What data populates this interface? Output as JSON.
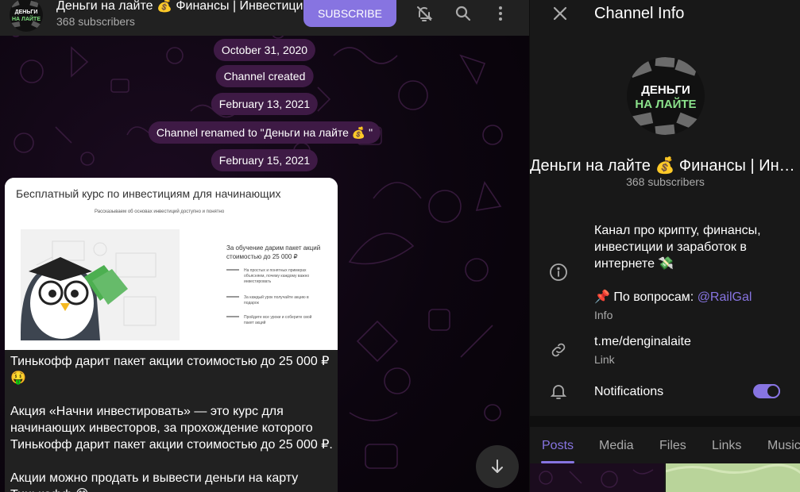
{
  "header": {
    "title": "Деньги на лайте 💰  Финансы | Инвестиции",
    "subscribers": "368 subscribers",
    "subscribe_label": "SUBSCRIBE"
  },
  "timeline": [
    {
      "kind": "date",
      "text": "October 31, 2020"
    },
    {
      "kind": "service",
      "text": "Channel created"
    },
    {
      "kind": "date",
      "text": "February 13, 2021"
    },
    {
      "kind": "service",
      "text": "Channel renamed to \"Деньги на лайте 💰 \""
    },
    {
      "kind": "date",
      "text": "February 15, 2021"
    }
  ],
  "post": {
    "image": {
      "heading": "Бесплатный курс по инвестициям для начинающих",
      "subheading": "Рассказываем об основах инвестиций доступно и понятно",
      "offer": "За обучение дарим пакет акций стоимостью до 25 000 ₽",
      "bullets": [
        "На простых и понятных примерах объясняем, почему каждому важно инвестировать",
        "За каждый урок получайте акцию в подарок",
        "Пройдите все уроки и соберите свой пакет акций"
      ]
    },
    "text": "Тинькофф дарит пакет акции стоимостью до 25 000 ₽ 🤑\n\nАкция «Начни инвестировать» — это курс для начинающих инвесторов, за прохождение которого Тинькофф дарит пакет акции стоимостью до 25 000 ₽.\n\nАкции можно продать и вывести деньги на карту Тинькофф 😋"
  },
  "info": {
    "panel_title": "Channel Info",
    "avatar_text_line1": "ДЕНЬГИ",
    "avatar_text_line2": "НА ЛАЙТЕ",
    "name": "Деньги на лайте 💰  Финансы | Инвестиции",
    "subscribers": "368 subscribers",
    "description": "Канал про крипту, финансы, инвестиции и заработок в интернете 💸",
    "contact_prefix": "📌  По вопросам: ",
    "contact_mention": "@RailGal",
    "description_caption": "Info",
    "link": "t.me/denginalaite",
    "link_caption": "Link",
    "notifications_label": "Notifications",
    "notifications_on": true,
    "tabs": [
      "Posts",
      "Media",
      "Files",
      "Links",
      "Music"
    ],
    "active_tab": "Posts"
  },
  "colors": {
    "accent": "#8774e1",
    "service_bubble": "#3e1a45",
    "panel_bg": "#181818",
    "header_bg": "#212121"
  },
  "icons": {
    "mute": "bell-off-icon",
    "search": "search-icon",
    "more": "more-vertical-icon",
    "close": "close-icon",
    "info": "info-icon",
    "link": "link-icon",
    "bell": "bell-icon",
    "scroll": "arrow-down-icon"
  }
}
